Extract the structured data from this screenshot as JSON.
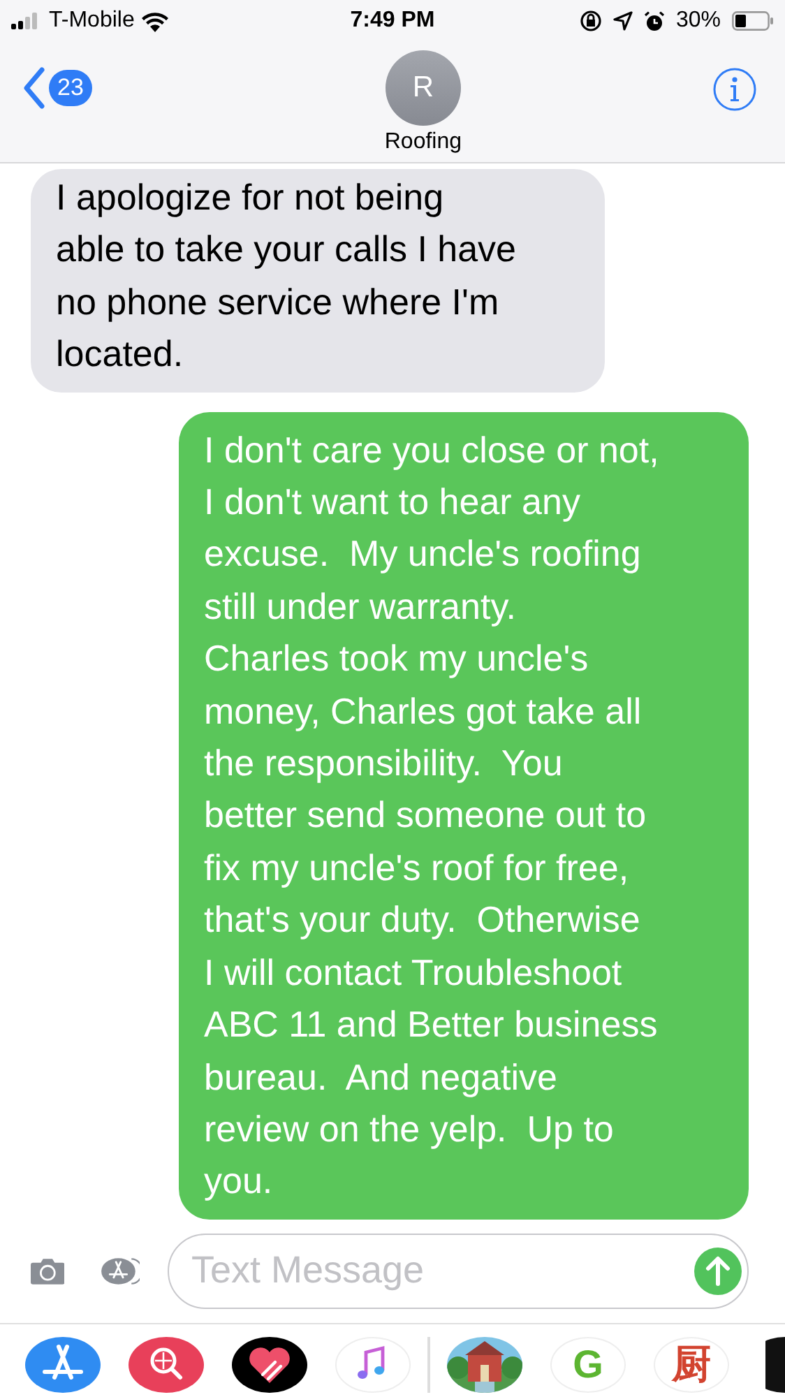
{
  "status_bar": {
    "carrier": "T-Mobile",
    "time": "7:49 PM",
    "battery": "30%"
  },
  "header": {
    "back_count": "23",
    "avatar_letter": "R",
    "contact": "Roofing"
  },
  "messages": [
    {
      "kind": "received",
      "text": "I apologize for not being\nable to take your calls I have\nno phone service where I'm\nlocated."
    },
    {
      "kind": "sent",
      "text": "I don't care you close or not,\nI don't want to hear any\nexcuse.  My uncle's roofing\nstill under warranty.\nCharles took my uncle's\nmoney, Charles got take all\nthe responsibility.  You\nbetter send someone out to\nfix my uncle's roof for free,\nthat's your duty.  Otherwise\nI will contact Troubleshoot\nABC 11 and Better business\nbureau.  And negative\nreview on the yelp.  Up to\nyou."
    }
  ],
  "composer": {
    "placeholder": "Text Message"
  },
  "apps": [
    {
      "kind": "appstore"
    },
    {
      "kind": "images"
    },
    {
      "kind": "heart"
    },
    {
      "kind": "music"
    },
    {
      "kind": "picture"
    },
    {
      "kind": "letter",
      "label": "G",
      "color": "#5cb531"
    },
    {
      "kind": "letter",
      "label": "厨",
      "color": "#d2432f"
    },
    {
      "kind": "partial"
    }
  ]
}
